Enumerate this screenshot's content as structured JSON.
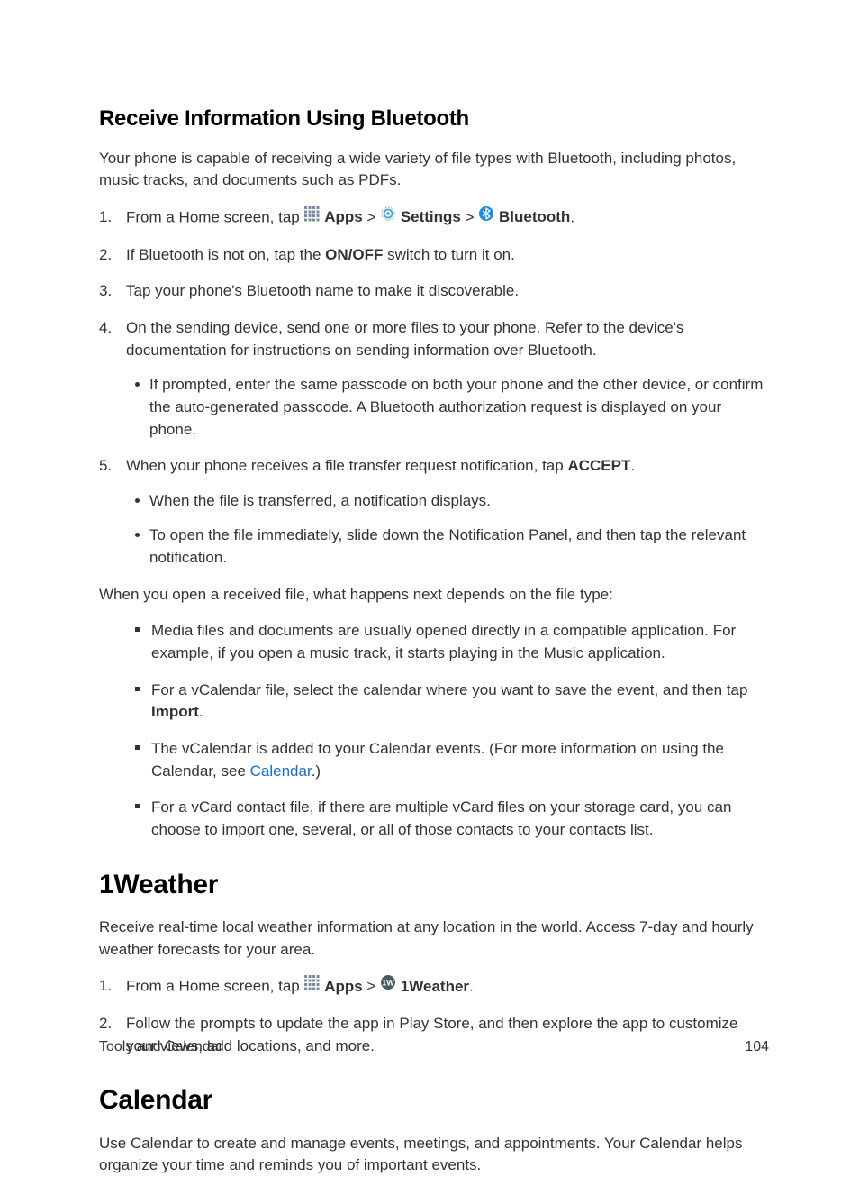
{
  "h2_bt": "Receive Information Using Bluetooth",
  "p_bt_intro": "Your phone is capable of receiving a wide variety of file types with Bluetooth, including photos, music tracks, and documents such as PDFs.",
  "li1_a": "From a Home screen, tap ",
  "apps": "Apps",
  "settings": "Settings",
  "bluetooth": "Bluetooth",
  "sep": " > ",
  "period": ".",
  "li2_a": "If Bluetooth is not on, tap the ",
  "onoff": "ON/OFF",
  "li2_b": " switch to turn it on.",
  "li3": "Tap your phone's Bluetooth name to make it discoverable.",
  "li4": "On the sending device, send one or more files to your phone. Refer to the device's documentation for instructions on sending information over Bluetooth.",
  "li4_sub": "If prompted, enter the same passcode on both your phone and the other device, or confirm the auto-generated passcode. A Bluetooth authorization request is displayed on your phone.",
  "li5_a": "When your phone receives a file transfer request notification, tap ",
  "accept": "ACCEPT",
  "li5_sub1": "When the file is transferred, a notification displays.",
  "li5_sub2": "To open the file immediately, slide down the Notification Panel, and then tap the relevant notification.",
  "p_open": "When you open a received file, what happens next depends on the file type:",
  "sq1": "Media files and documents are usually opened directly in a compatible application. For example, if you open a music track, it starts playing in the Music application.",
  "sq2_a": "For a vCalendar file, select the calendar where you want to save the event, and then tap ",
  "import": "Import",
  "sq3_a": "The vCalendar is added to your Calendar events. (For more information on using the Calendar, see ",
  "calendar_link": "Calendar",
  "sq3_b": ".)",
  "sq4": "For a vCard contact file, if there are multiple vCard files on your storage card, you can choose to import one, several, or all of those contacts to your contacts list.",
  "h1_weather": "1Weather",
  "p_weather": "Receive real-time local weather information at any location in the world. Access 7-day and hourly weather forecasts for your area.",
  "w_li1_a": "From a Home screen, tap ",
  "oneweather": "1Weather",
  "w_li2": "Follow the prompts to update the app in Play Store, and then explore the app to customize your views, add locations, and more.",
  "h1_cal": "Calendar",
  "p_cal": "Use Calendar to create and manage events, meetings, and appointments. Your Calendar helps organize your time and reminds you of important events.",
  "footer_left": "Tools and Calendar",
  "footer_right": "104"
}
